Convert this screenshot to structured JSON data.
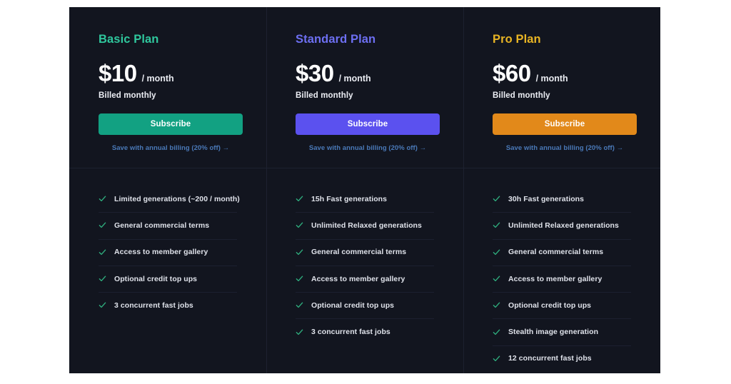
{
  "theme": {
    "page_background": "#ffffff",
    "card_background": "#12151f",
    "divider_color": "#1d2130",
    "check_color": "#2fae7e",
    "link_color": "#4a79b8",
    "text_color": "#dfe2ea"
  },
  "plans": [
    {
      "title": "Basic Plan",
      "title_color": "#2fc79d",
      "price": "$10",
      "period": "/ month",
      "billed": "Billed monthly",
      "button_label": "Subscribe",
      "button_color": "#12a182",
      "annual_link": "Save with annual billing (20% off) →",
      "features": [
        "Limited generations (~200 / month)",
        "General commercial terms",
        "Access to member gallery",
        "Optional credit top ups",
        "3 concurrent fast jobs"
      ]
    },
    {
      "title": "Standard Plan",
      "title_color": "#6d6ff2",
      "price": "$30",
      "period": "/ month",
      "billed": "Billed monthly",
      "button_label": "Subscribe",
      "button_color": "#5b51ef",
      "annual_link": "Save with annual billing (20% off) →",
      "features": [
        "15h Fast generations",
        "Unlimited Relaxed generations",
        "General commercial terms",
        "Access to member gallery",
        "Optional credit top ups",
        "3 concurrent fast jobs"
      ]
    },
    {
      "title": "Pro Plan",
      "title_color": "#e8b424",
      "price": "$60",
      "period": "/ month",
      "billed": "Billed monthly",
      "button_label": "Subscribe",
      "button_color": "#e2891a",
      "annual_link": "Save with annual billing (20% off) →",
      "features": [
        "30h Fast generations",
        "Unlimited Relaxed generations",
        "General commercial terms",
        "Access to member gallery",
        "Optional credit top ups",
        "Stealth image generation",
        "12 concurrent fast jobs"
      ]
    }
  ],
  "icons": {
    "check": "check-icon"
  }
}
